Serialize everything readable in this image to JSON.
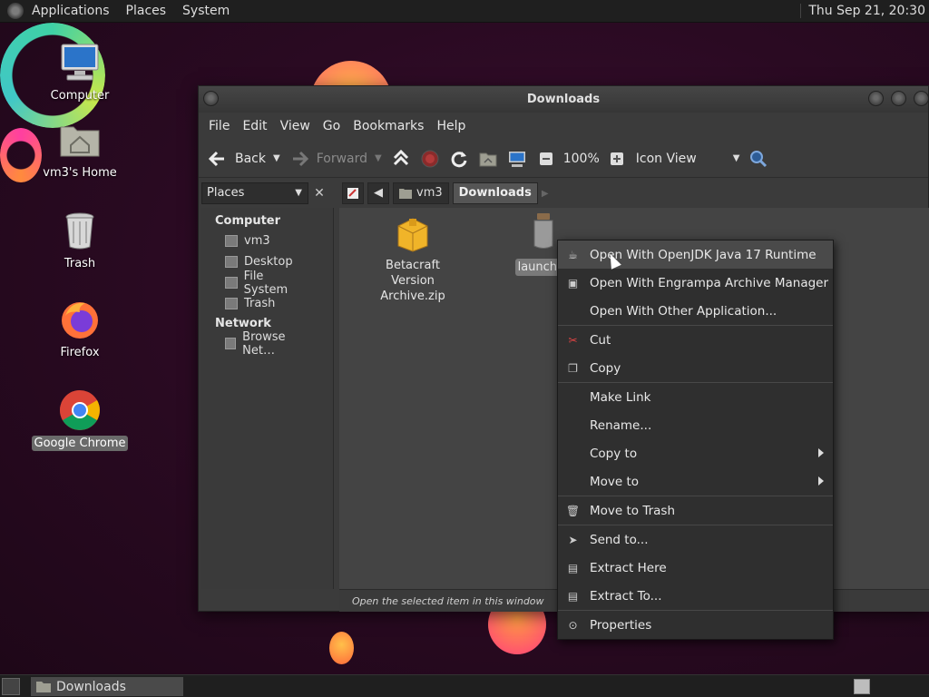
{
  "top_panel": {
    "menus": [
      "Applications",
      "Places",
      "System"
    ],
    "clock": "Thu Sep 21, 20:30"
  },
  "desktop": {
    "icons": [
      {
        "label": "Computer",
        "icon": "computer-icon"
      },
      {
        "label": "vm3's Home",
        "icon": "home-folder-icon"
      },
      {
        "label": "Trash",
        "icon": "trash-icon"
      },
      {
        "label": "Firefox",
        "icon": "firefox-icon"
      },
      {
        "label": "Google Chrome",
        "icon": "chrome-icon"
      }
    ]
  },
  "window": {
    "title": "Downloads",
    "menubar": [
      "File",
      "Edit",
      "View",
      "Go",
      "Bookmarks",
      "Help"
    ],
    "toolbar": {
      "back": "Back",
      "forward": "Forward",
      "zoom": "100%",
      "view_mode": "Icon View"
    },
    "places_combo": "Places",
    "path": [
      "vm3",
      "Downloads"
    ],
    "sidebar": {
      "computer_heading": "Computer",
      "computer_items": [
        "vm3",
        "Desktop",
        "File System",
        "Trash"
      ],
      "network_heading": "Network",
      "network_items": [
        "Browse Net…"
      ]
    },
    "files": [
      {
        "name": "Betacraft Version Archive.zip",
        "icon": "package-icon"
      },
      {
        "name": "launcher",
        "icon": "jar-icon",
        "selected": true
      }
    ],
    "status": "Open the selected item in this window"
  },
  "context_menu": {
    "items": [
      {
        "label": "Open With OpenJDK Java 17 Runtime",
        "icon": "java-icon",
        "highlighted": true
      },
      {
        "label": "Open With Engrampa Archive Manager",
        "icon": "archive-icon"
      },
      {
        "label": "Open With Other Application...",
        "icon": ""
      },
      {
        "label": "Cut",
        "icon": "scissors-icon"
      },
      {
        "label": "Copy",
        "icon": "copy-icon"
      },
      {
        "label": "Make Link",
        "icon": ""
      },
      {
        "label": "Rename...",
        "icon": ""
      },
      {
        "label": "Copy to",
        "icon": "",
        "submenu": true
      },
      {
        "label": "Move to",
        "icon": "",
        "submenu": true
      },
      {
        "label": "Move to Trash",
        "icon": "trash-icon"
      },
      {
        "label": "Send to...",
        "icon": "send-icon"
      },
      {
        "label": "Extract Here",
        "icon": "extract-icon"
      },
      {
        "label": "Extract To...",
        "icon": "extract-icon"
      },
      {
        "label": "Properties",
        "icon": "properties-icon"
      }
    ]
  },
  "bottom_panel": {
    "task_label": "Downloads"
  },
  "colors": {
    "panel": "#1f1f1f",
    "window_bg": "#3b3b3b",
    "content_bg": "#444444",
    "menu_bg": "#2f2f2f",
    "highlight": "#4a4a4a"
  }
}
